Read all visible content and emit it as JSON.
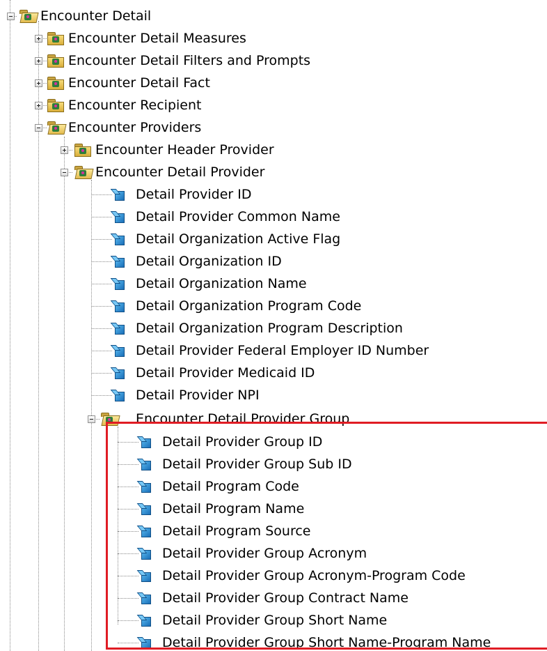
{
  "tree": {
    "root": {
      "label": "Encounter Detail"
    },
    "level1": [
      {
        "label": "Encounter Detail Measures"
      },
      {
        "label": "Encounter Detail Filters and Prompts"
      },
      {
        "label": "Encounter Detail Fact"
      },
      {
        "label": "Encounter Recipient"
      },
      {
        "label": "Encounter Providers"
      }
    ],
    "providers": [
      {
        "label": "Encounter Header Provider"
      },
      {
        "label": "Encounter Detail Provider"
      }
    ],
    "detail_provider_items": [
      {
        "label": "Detail Provider ID"
      },
      {
        "label": "Detail Provider Common Name"
      },
      {
        "label": "Detail Organization Active Flag"
      },
      {
        "label": "Detail Organization ID"
      },
      {
        "label": "Detail Organization Name"
      },
      {
        "label": "Detail Organization Program Code"
      },
      {
        "label": "Detail Organization Program Description"
      },
      {
        "label": "Detail Provider Federal Employer ID Number"
      },
      {
        "label": "Detail Provider Medicaid ID"
      },
      {
        "label": "Detail Provider NPI"
      }
    ],
    "group": {
      "label": "Encounter Detail Provider Group"
    },
    "group_items": [
      {
        "label": "Detail Provider Group ID"
      },
      {
        "label": "Detail Provider Group Sub ID"
      },
      {
        "label": "Detail Program Code"
      },
      {
        "label": "Detail Program Name"
      },
      {
        "label": "Detail Program Source"
      },
      {
        "label": "Detail Provider Group Acronym"
      },
      {
        "label": "Detail Provider Group Acronym-Program Code"
      },
      {
        "label": "Detail Provider Group Contract Name"
      },
      {
        "label": "Detail Provider Group Short Name"
      },
      {
        "label": "Detail Provider Group Short Name-Program Name"
      }
    ]
  },
  "colors": {
    "highlight_border": "#e01c24",
    "tree_lines": "#8a8a8a"
  }
}
